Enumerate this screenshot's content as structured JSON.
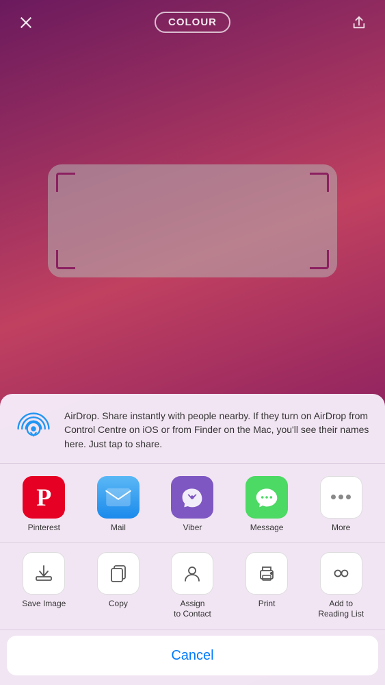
{
  "topbar": {
    "title": "COLOUR",
    "close_label": "close",
    "share_label": "share"
  },
  "airdrop": {
    "title": "AirDrop",
    "description": "AirDrop. Share instantly with people nearby. If they turn on AirDrop from Control Centre on iOS or from Finder on the Mac, you'll see their names here. Just tap to share."
  },
  "apps": [
    {
      "id": "pinterest",
      "label": "Pinterest"
    },
    {
      "id": "mail",
      "label": "Mail"
    },
    {
      "id": "viber",
      "label": "Viber"
    },
    {
      "id": "message",
      "label": "Message"
    },
    {
      "id": "more",
      "label": "More"
    }
  ],
  "actions": [
    {
      "id": "save-image",
      "label": "Save Image"
    },
    {
      "id": "copy",
      "label": "Copy"
    },
    {
      "id": "assign-contact",
      "label": "Assign\nto Contact"
    },
    {
      "id": "print",
      "label": "Print"
    },
    {
      "id": "reading-list",
      "label": "Add to\nReading List"
    }
  ],
  "cancel": {
    "label": "Cancel"
  }
}
